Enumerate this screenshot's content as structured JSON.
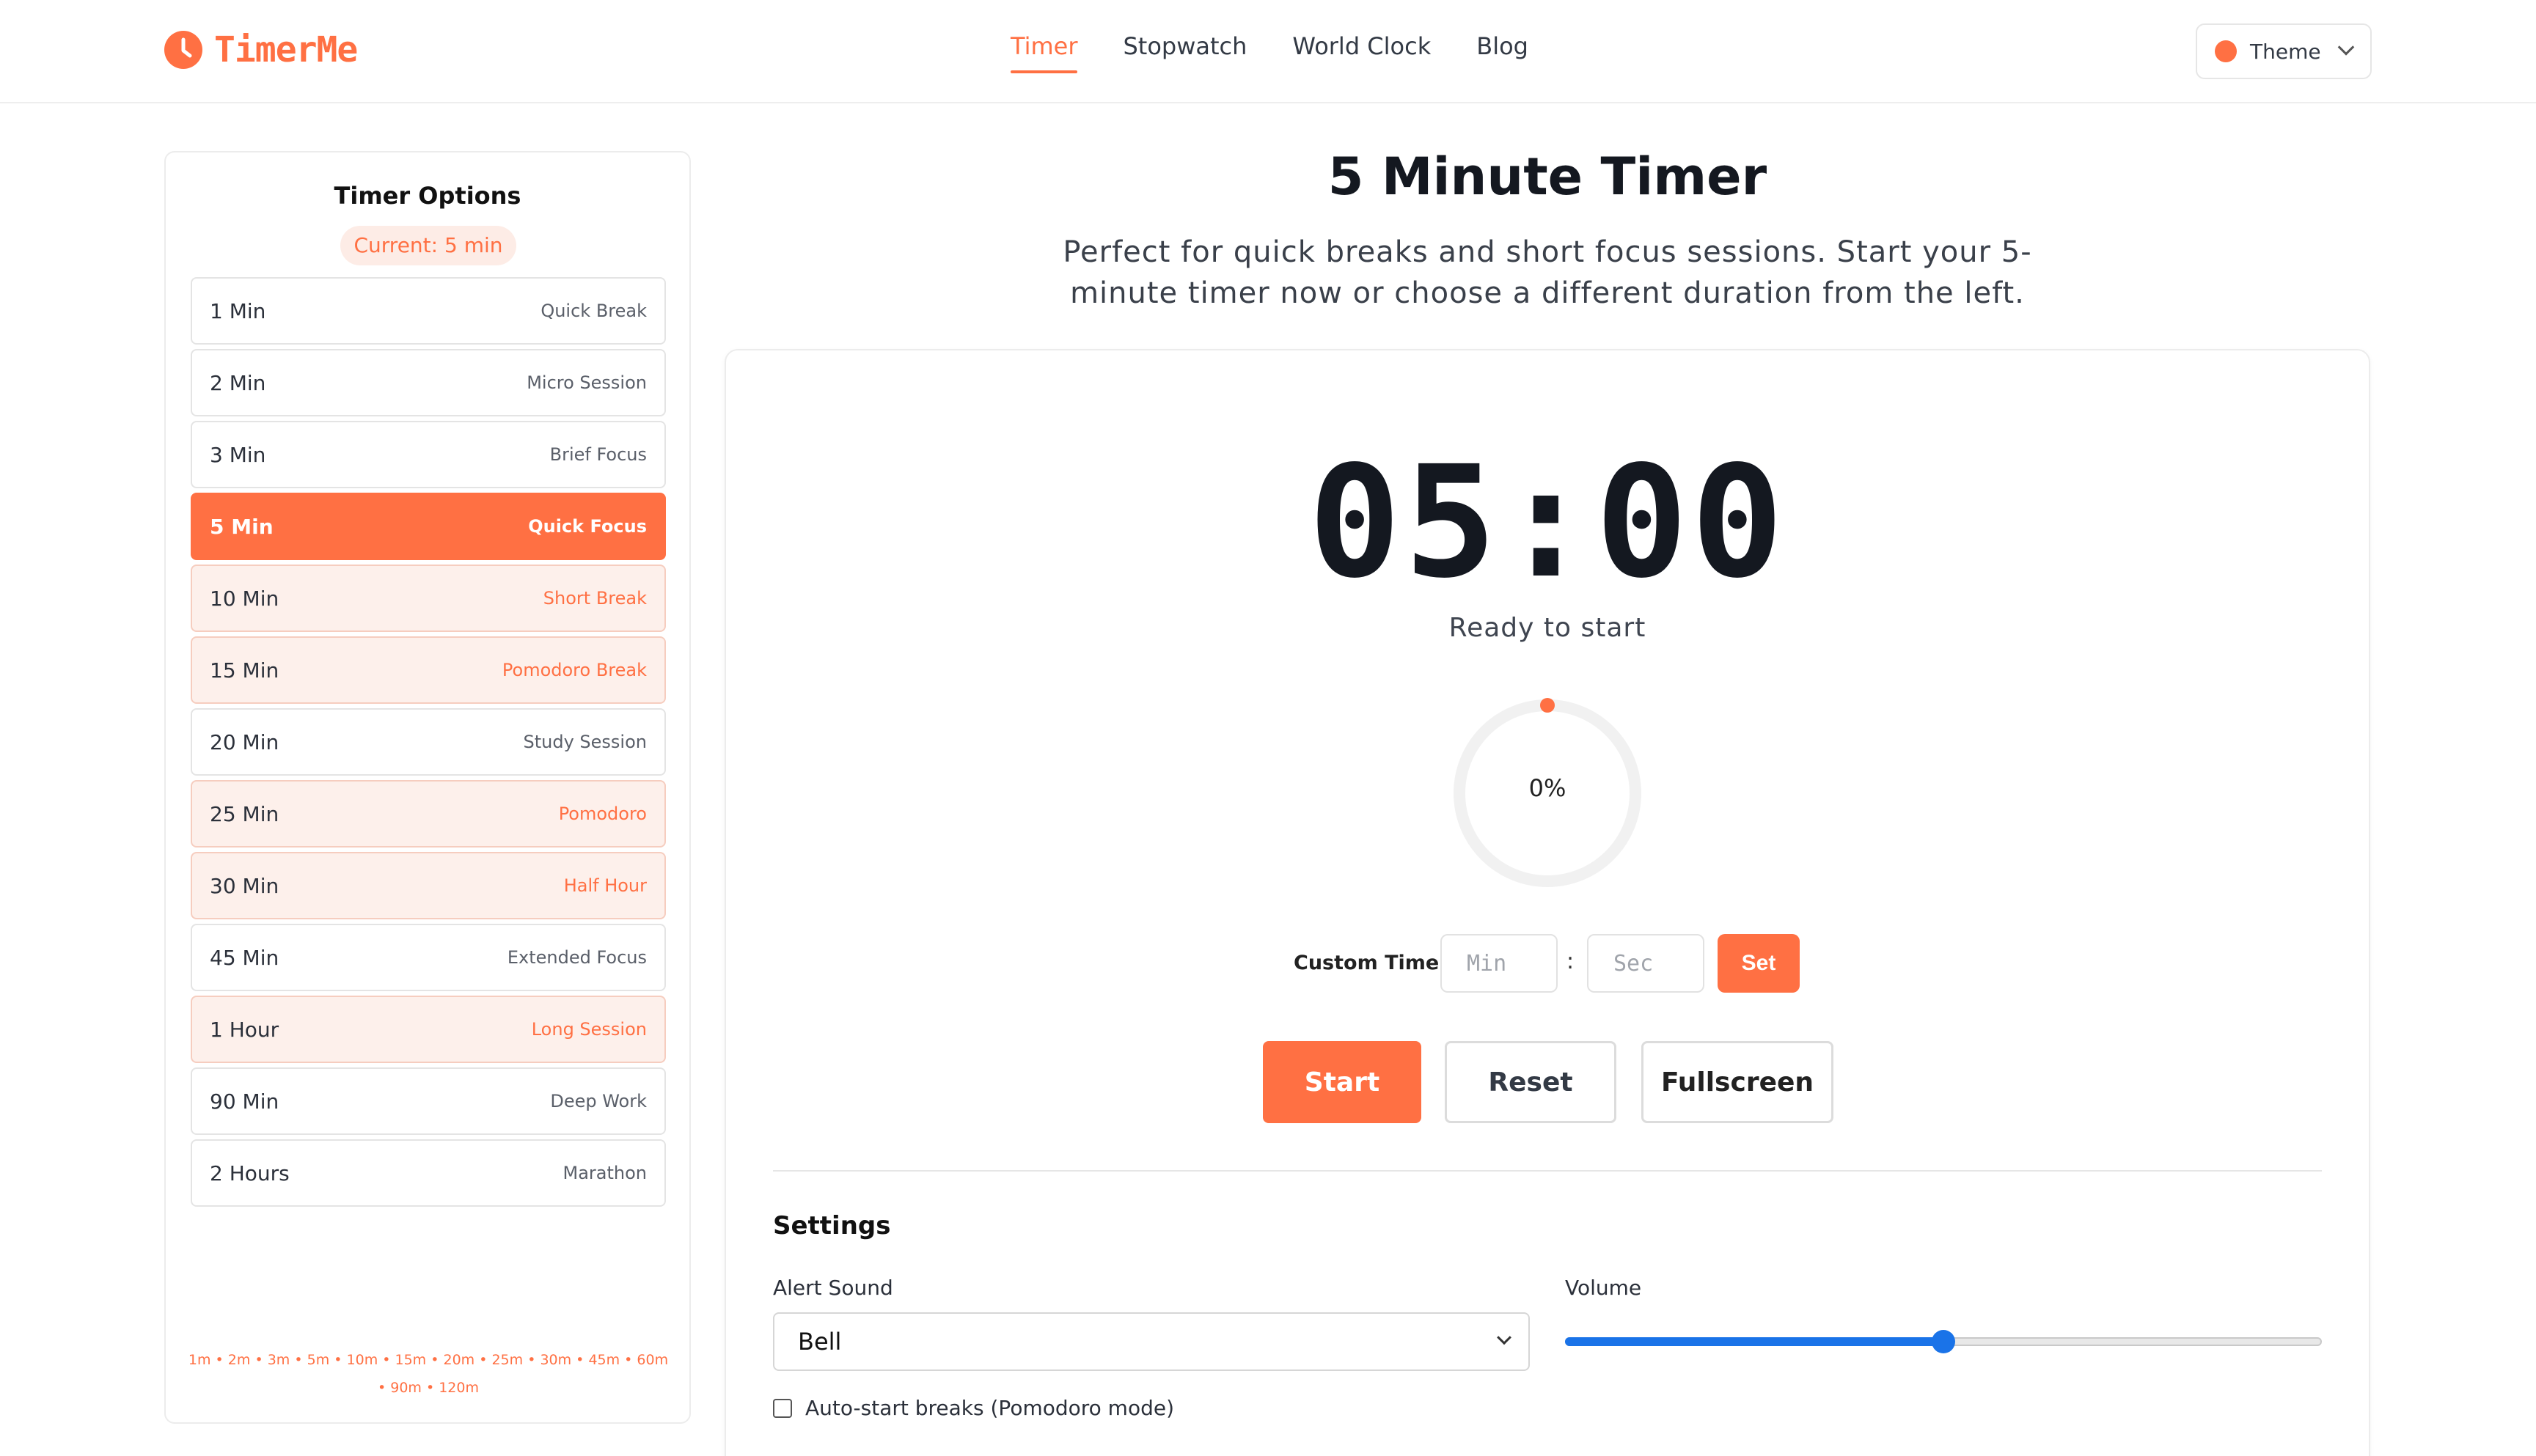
{
  "brand": {
    "name": "TimerMe",
    "color": "#ff7043",
    "icon": "clock-icon"
  },
  "nav": [
    {
      "label": "Timer",
      "active": true
    },
    {
      "label": "Stopwatch",
      "active": false
    },
    {
      "label": "World Clock",
      "active": false
    },
    {
      "label": "Blog",
      "active": false
    }
  ],
  "theme": {
    "label": "Theme",
    "swatch": "#ff7043",
    "icon": "chevron-down-icon"
  },
  "sidebar": {
    "title": "Timer Options",
    "current": "Current: 5 min",
    "options": [
      {
        "label": "1 Min",
        "desc": "Quick Break",
        "style": "plain"
      },
      {
        "label": "2 Min",
        "desc": "Micro Session",
        "style": "plain"
      },
      {
        "label": "3 Min",
        "desc": "Brief Focus",
        "style": "plain"
      },
      {
        "label": "5 Min",
        "desc": "Quick Focus",
        "style": "selected"
      },
      {
        "label": "10 Min",
        "desc": "Short Break",
        "style": "tinted"
      },
      {
        "label": "15 Min",
        "desc": "Pomodoro Break",
        "style": "tinted"
      },
      {
        "label": "20 Min",
        "desc": "Study Session",
        "style": "plain"
      },
      {
        "label": "25 Min",
        "desc": "Pomodoro",
        "style": "tinted"
      },
      {
        "label": "30 Min",
        "desc": "Half Hour",
        "style": "tinted"
      },
      {
        "label": "45 Min",
        "desc": "Extended Focus",
        "style": "plain"
      },
      {
        "label": "1 Hour",
        "desc": "Long Session",
        "style": "tinted"
      },
      {
        "label": "90 Min",
        "desc": "Deep Work",
        "style": "plain"
      },
      {
        "label": "2 Hours",
        "desc": "Marathon",
        "style": "plain"
      }
    ],
    "quick_links": [
      "1m",
      "2m",
      "3m",
      "5m",
      "10m",
      "15m",
      "20m",
      "25m",
      "30m",
      "45m",
      "60m",
      "90m",
      "120m"
    ]
  },
  "main": {
    "title": "5 Minute Timer",
    "subtitle": "Perfect for quick breaks and short focus sessions. Start your 5-minute timer now or choose a different duration from the left.",
    "clock": "05:00",
    "status": "Ready to start",
    "progress": {
      "percent_label": "0%",
      "fraction": 0
    },
    "custom": {
      "label": "Custom Timer",
      "min_placeholder": "Min",
      "sec_placeholder": "Sec",
      "separator": ":",
      "set_label": "Set"
    },
    "buttons": {
      "start": "Start",
      "reset": "Reset",
      "fullscreen": "Fullscreen"
    },
    "settings": {
      "title": "Settings",
      "alert_label": "Alert Sound",
      "alert_value": "Bell",
      "volume_label": "Volume",
      "volume_fraction": 0.5,
      "auto_start_label": "Auto-start breaks (Pomodoro mode)",
      "auto_start_checked": false
    }
  }
}
